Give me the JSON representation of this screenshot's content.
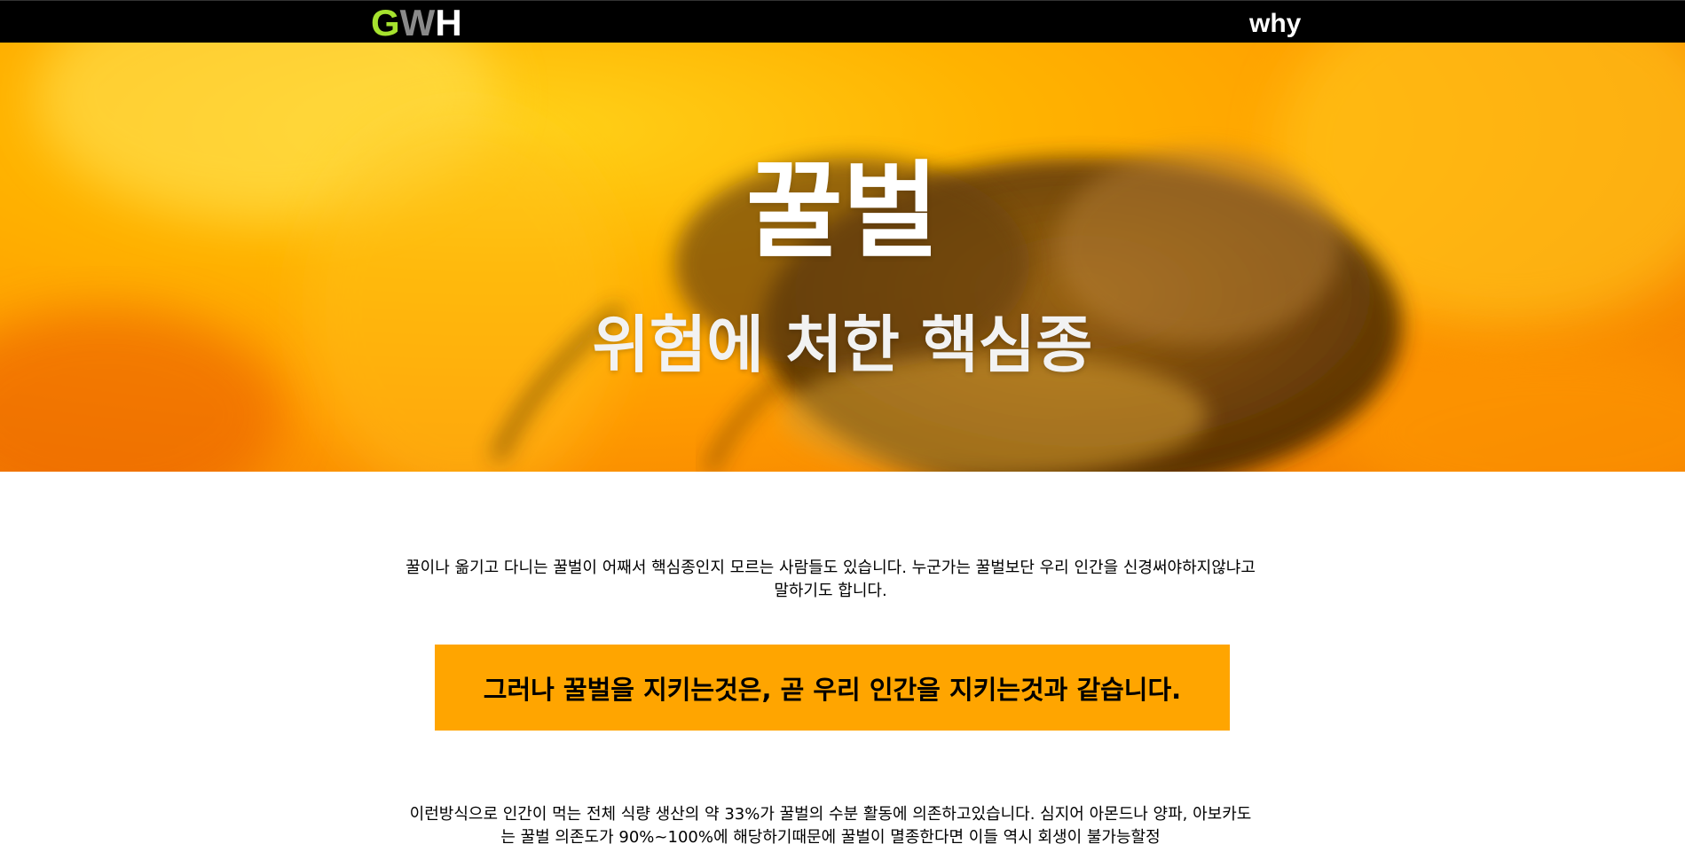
{
  "header": {
    "logo": {
      "g": "G",
      "w": "W",
      "h": "H"
    },
    "nav_why": "why"
  },
  "hero": {
    "title": "꿀벌",
    "subtitle": "위험에 처한 핵심종"
  },
  "content": {
    "intro": "꿀이나 옮기고 다니는 꿀벌이 어째서 핵심종인지 모르는 사람들도 있습니다. 누군가는 꿀벌보단 우리 인간을 신경써야하지않냐고 말하기도 합니다.",
    "callout": "그러나 꿀벌을 지키는것은, 곧 우리 인간을 지키는것과 같습니다.",
    "paragraph2": "이런방식으로 인간이 먹는 전체 식량 생산의 약 33%가 꿀벌의 수분 활동에 의존하고있습니다. 심지어 아몬드나 양파, 아보카도는 꿀벌 의존도가 90%~100%에 해당하기때문에 꿀벌이 멸종한다면 이들 역시 회생이 불가능할정"
  },
  "colors": {
    "topbar": "#000000",
    "logo_g": "#a6e22e",
    "logo_w": "#8a8a8a",
    "logo_h": "#ffffff",
    "callout_bg": "#ffa500"
  }
}
